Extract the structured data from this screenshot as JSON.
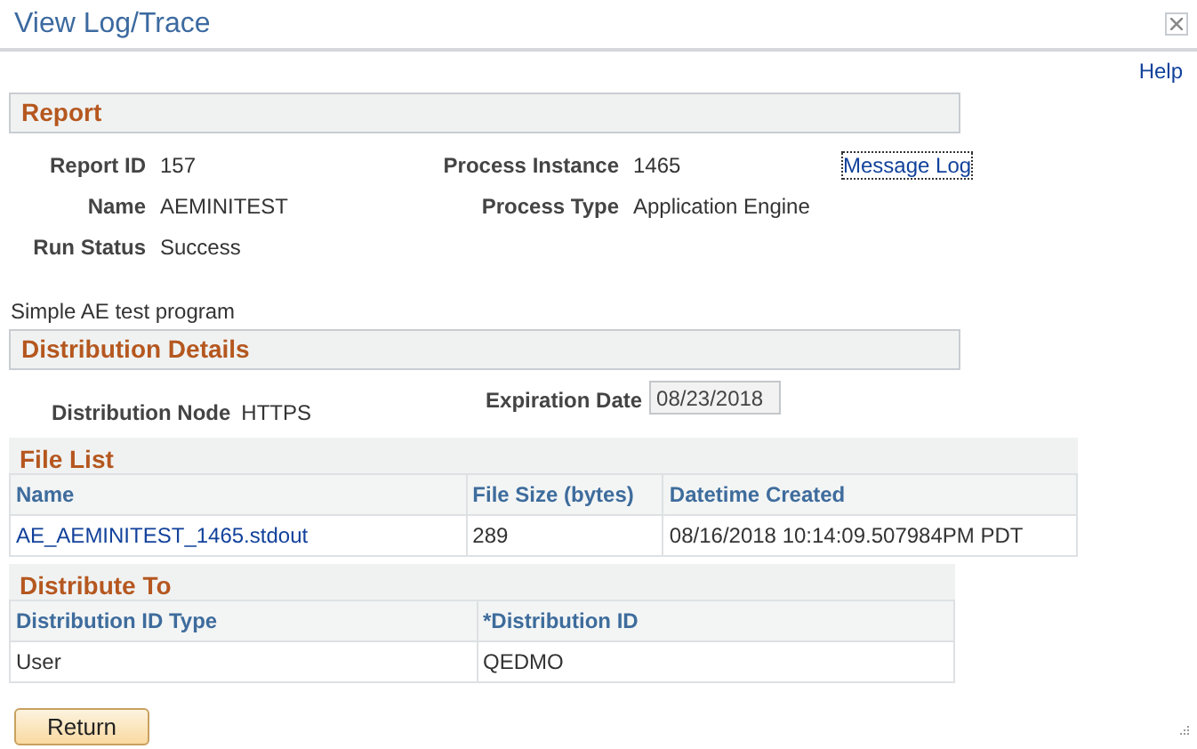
{
  "window": {
    "title": "View Log/Trace"
  },
  "help_link": "Help",
  "report": {
    "heading": "Report",
    "fields": [
      {
        "label": "Report ID",
        "value": "157"
      },
      {
        "label": "Process Instance",
        "value": "1465"
      },
      {
        "label": "Name",
        "value": "AEMINITEST"
      },
      {
        "label": "Process Type",
        "value": "Application Engine"
      },
      {
        "label": "Run Status",
        "value": "Success"
      }
    ],
    "message_log_link": "Message Log"
  },
  "description": "Simple AE test program",
  "distribution_details": {
    "heading": "Distribution Details",
    "node_label": "Distribution Node",
    "node_value": "HTTPS",
    "expiration_label": "Expiration Date",
    "expiration_value": "08/23/2018"
  },
  "file_list": {
    "heading": "File List",
    "columns": [
      "Name",
      "File Size (bytes)",
      "Datetime Created"
    ],
    "rows": [
      [
        "AE_AEMINITEST_1465.stdout",
        "289",
        "08/16/2018 10:14:09.507984PM PDT"
      ]
    ]
  },
  "distribute_to": {
    "heading": "Distribute To",
    "columns": [
      "Distribution ID Type",
      "*Distribution ID"
    ],
    "rows": [
      [
        "User",
        "QEDMO"
      ]
    ]
  },
  "buttons": [
    "Return"
  ]
}
